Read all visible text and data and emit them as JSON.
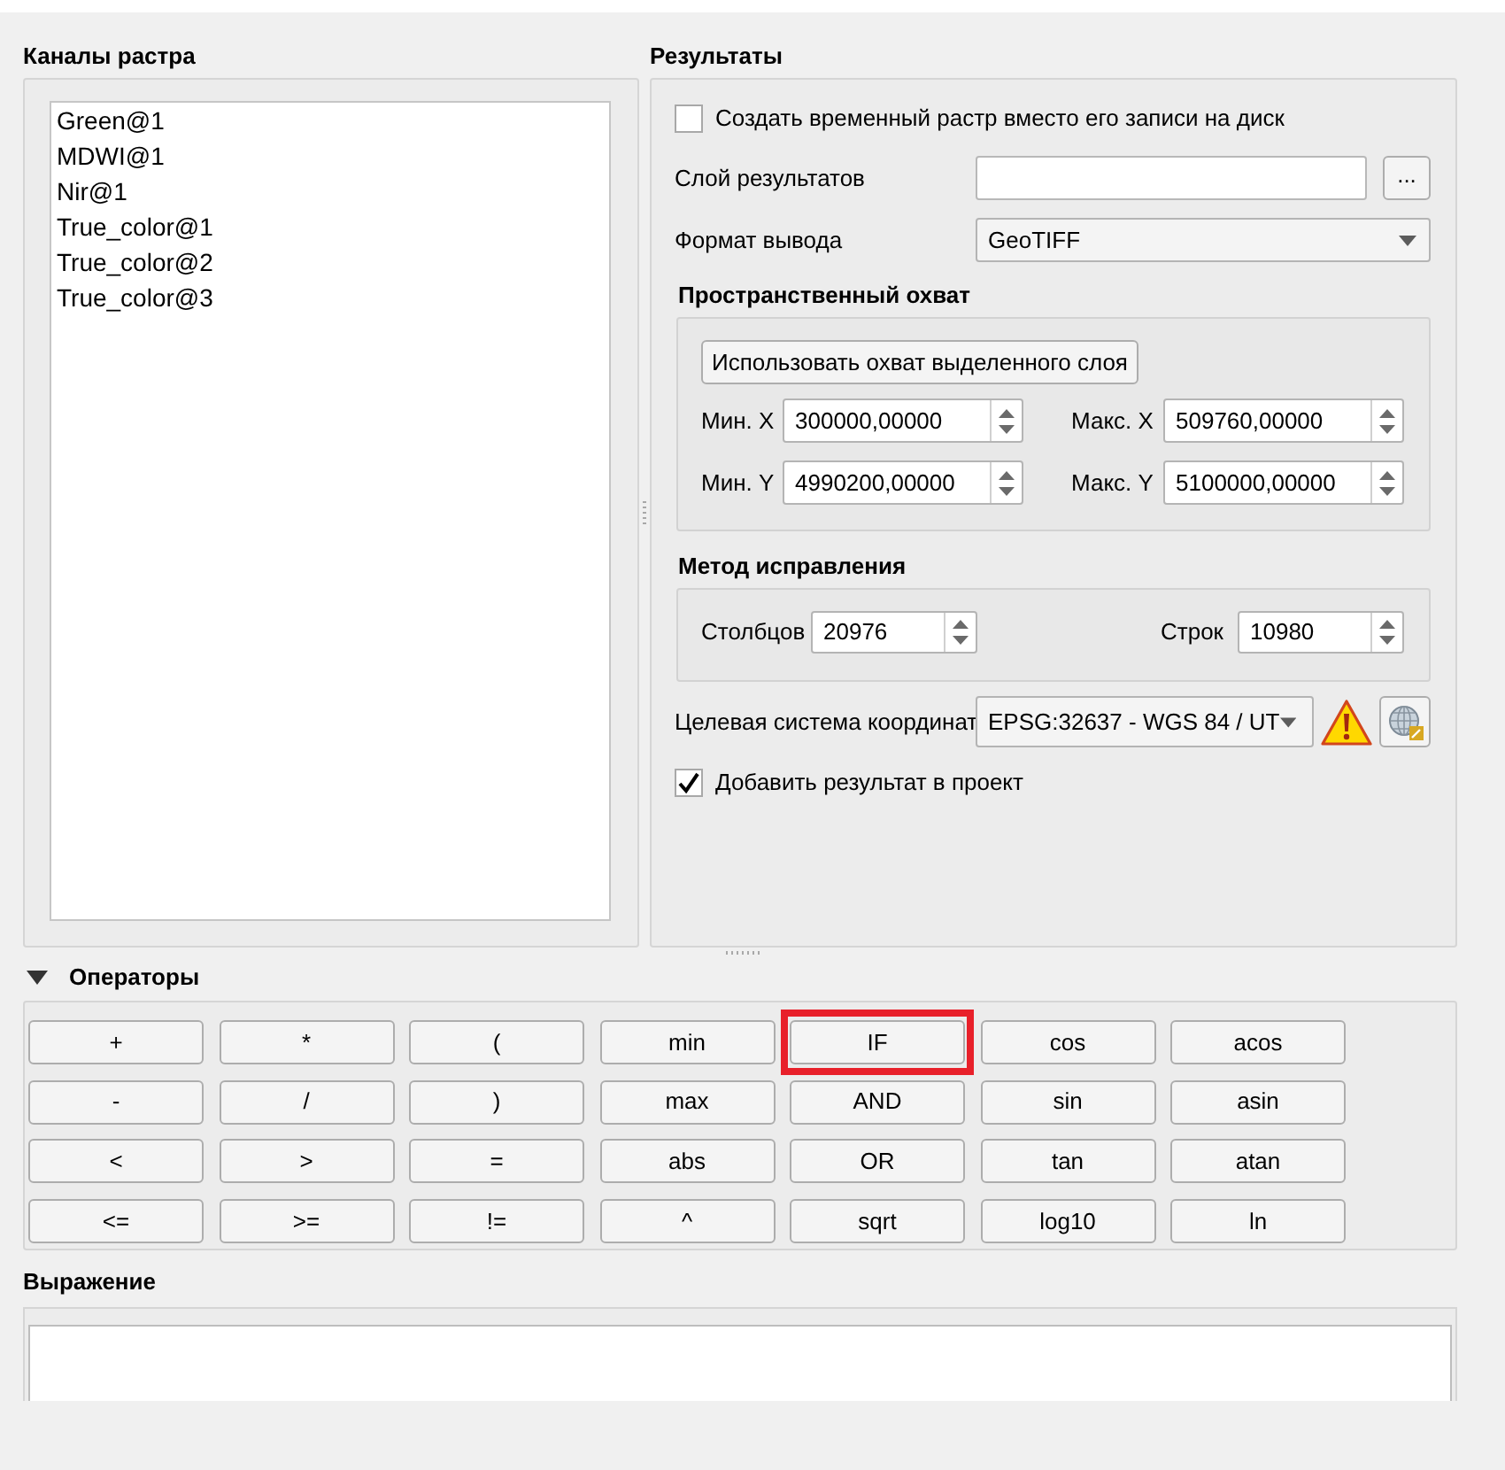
{
  "raster_bands": {
    "title": "Каналы растра",
    "items": [
      "Green@1",
      "MDWI@1",
      "Nir@1",
      "True_color@1",
      "True_color@2",
      "True_color@3"
    ]
  },
  "results": {
    "title": "Результаты",
    "temporary_raster": {
      "label": "Создать временный растр вместо его записи на диск",
      "checked": false
    },
    "output_layer": {
      "label": "Слой результатов",
      "browse_button": "..."
    },
    "output_format": {
      "label": "Формат вывода",
      "value": "GeoTIFF"
    },
    "spatial_extent": {
      "title": "Пространственный охват",
      "layer_extent_button": "Использовать охват выделенного слоя",
      "fields": [
        {
          "label": "Мин. X",
          "value": "300000,00000"
        },
        {
          "label": "Макс. X",
          "value": "509760,00000"
        },
        {
          "label": "Мин. Y",
          "value": "4990200,00000"
        },
        {
          "label": "Макс. Y",
          "value": "5100000,00000"
        }
      ]
    },
    "resolution": {
      "title": "Метод исправления",
      "fields": [
        {
          "label": "Столбцов",
          "value": "20976"
        },
        {
          "label": "Строк",
          "value": "10980"
        }
      ]
    },
    "target_crs": {
      "label": "Целевая система координат",
      "value": "EPSG:32637 - WGS 84 / UT"
    },
    "add_to_project": {
      "label": "Добавить результат в проект",
      "checked": true
    }
  },
  "operators": {
    "title": "Операторы",
    "expanded": true,
    "buttons": [
      {
        "label": "+",
        "highlighted": false
      },
      {
        "label": "*",
        "highlighted": false
      },
      {
        "label": "(",
        "highlighted": false
      },
      {
        "label": "min",
        "highlighted": false
      },
      {
        "label": "IF",
        "highlighted": true
      },
      {
        "label": "cos",
        "highlighted": false
      },
      {
        "label": "acos",
        "highlighted": false
      },
      {
        "label": "-",
        "highlighted": false
      },
      {
        "label": "/",
        "highlighted": false
      },
      {
        "label": ")",
        "highlighted": false
      },
      {
        "label": "max",
        "highlighted": false
      },
      {
        "label": "AND",
        "highlighted": false
      },
      {
        "label": "sin",
        "highlighted": false
      },
      {
        "label": "asin",
        "highlighted": false
      },
      {
        "label": "<",
        "highlighted": false
      },
      {
        "label": ">",
        "highlighted": false
      },
      {
        "label": "=",
        "highlighted": false
      },
      {
        "label": "abs",
        "highlighted": false
      },
      {
        "label": "OR",
        "highlighted": false
      },
      {
        "label": "tan",
        "highlighted": false
      },
      {
        "label": "atan",
        "highlighted": false
      },
      {
        "label": "<=",
        "highlighted": false
      },
      {
        "label": ">=",
        "highlighted": false
      },
      {
        "label": "!=",
        "highlighted": false
      },
      {
        "label": "^",
        "highlighted": false
      },
      {
        "label": "sqrt",
        "highlighted": false
      },
      {
        "label": "log10",
        "highlighted": false
      },
      {
        "label": "ln",
        "highlighted": false
      }
    ]
  },
  "expression": {
    "title": "Выражение"
  }
}
